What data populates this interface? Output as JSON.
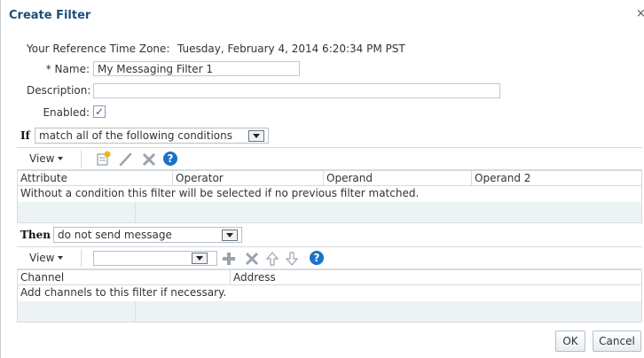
{
  "dialog": {
    "title": "Create Filter",
    "close": "×"
  },
  "form": {
    "timezone_label": "Your Reference Time Zone:",
    "timezone_value": "Tuesday, February 4, 2014 6:20:34 PM PST",
    "name_label": "* Name:",
    "name_value": "My Messaging Filter 1",
    "description_label": "Description:",
    "description_value": "",
    "enabled_label": "Enabled:",
    "enabled_checked": "✓"
  },
  "if_section": {
    "label": "If",
    "selected": "match all of the following conditions",
    "toolbar": {
      "view_label": "View"
    },
    "columns": [
      "Attribute",
      "Operator",
      "Operand",
      "Operand 2"
    ],
    "empty_text": "Without a condition this filter will be selected if no previous filter matched."
  },
  "then_section": {
    "label": "Then",
    "selected": "do not send message",
    "toolbar": {
      "view_label": "View",
      "channel_select": ""
    },
    "columns": [
      "Channel",
      "Address"
    ],
    "empty_text": "Add channels to this filter if necessary."
  },
  "buttons": {
    "ok": "OK",
    "cancel": "Cancel"
  },
  "colors": {
    "title": "#1f4d7a",
    "help_icon": "#1a73c9",
    "add_icon": "#9aa3ad",
    "filler": "#edf3f5"
  }
}
